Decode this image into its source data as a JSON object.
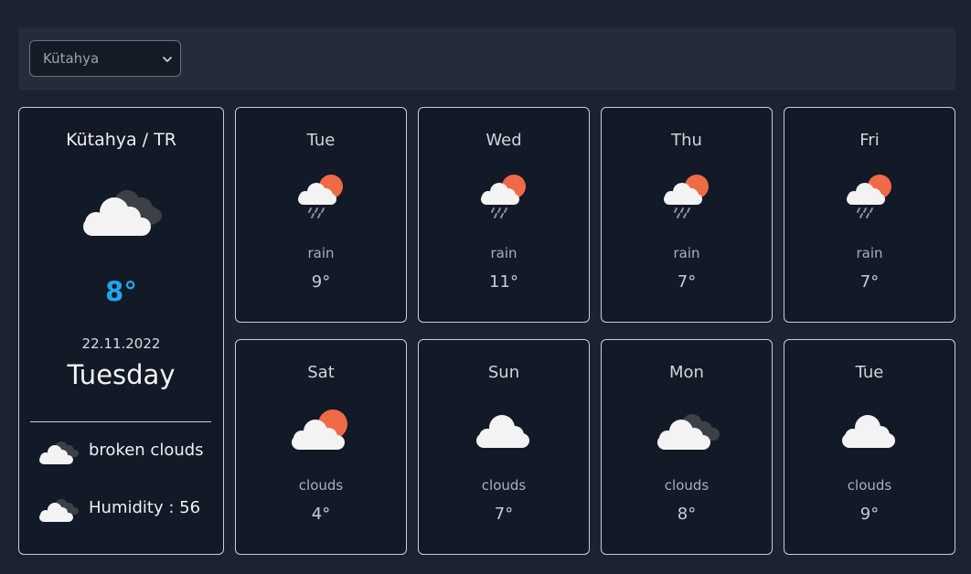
{
  "city_select": {
    "selected": "Kütahya"
  },
  "current": {
    "location": "Kütahya / TR",
    "icon": "broken-clouds-icon",
    "temperature": "8°",
    "date": "22.11.2022",
    "weekday": "Tuesday",
    "description": "broken clouds",
    "humidity": "Humidity : 56"
  },
  "forecast": [
    {
      "day": "Tue",
      "icon": "rain-sun-icon",
      "desc": "rain",
      "temp": "9°"
    },
    {
      "day": "Wed",
      "icon": "rain-sun-icon",
      "desc": "rain",
      "temp": "11°"
    },
    {
      "day": "Thu",
      "icon": "rain-sun-icon",
      "desc": "rain",
      "temp": "7°"
    },
    {
      "day": "Fri",
      "icon": "rain-sun-icon",
      "desc": "rain",
      "temp": "7°"
    },
    {
      "day": "Sat",
      "icon": "few-clouds-sun-icon",
      "desc": "clouds",
      "temp": "4°"
    },
    {
      "day": "Sun",
      "icon": "cloud-icon",
      "desc": "clouds",
      "temp": "7°"
    },
    {
      "day": "Mon",
      "icon": "broken-clouds-icon",
      "desc": "clouds",
      "temp": "8°"
    },
    {
      "day": "Tue",
      "icon": "cloud-icon",
      "desc": "clouds",
      "temp": "9°"
    }
  ],
  "colors": {
    "background": "#1b2230",
    "card": "#121927",
    "accent_temp": "#1ea7ea",
    "sun": "#f06a45"
  }
}
